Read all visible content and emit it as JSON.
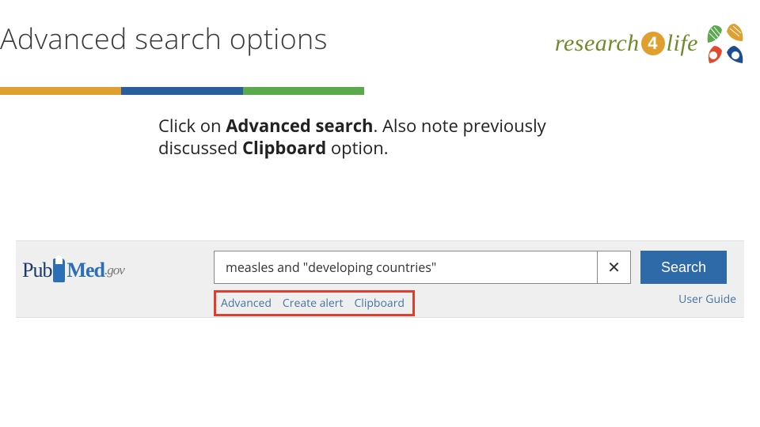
{
  "title": "Advanced search options",
  "logo": {
    "text_left": "research",
    "digit": "4",
    "text_right": "life"
  },
  "instruction": {
    "pre1": "Click on ",
    "bold1": "Advanced search",
    "mid1": ".  Also note previously discussed ",
    "bold2": "Clipboard",
    "post": " option."
  },
  "pubmed": {
    "pub": "Pub",
    "med": "Med",
    "gov": ".gov"
  },
  "search": {
    "value": "measles and \"developing countries\"",
    "clear": "✕",
    "button": "Search"
  },
  "links": {
    "advanced": "Advanced",
    "create_alert": "Create alert",
    "clipboard": "Clipboard",
    "user_guide": "User Guide"
  }
}
